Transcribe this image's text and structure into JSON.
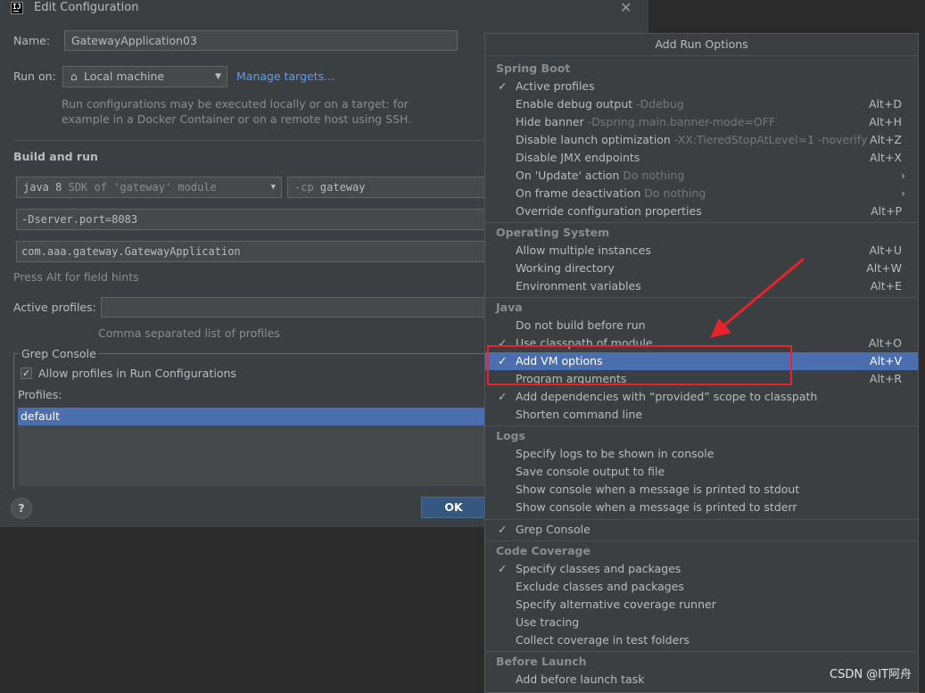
{
  "dialog": {
    "title": "Edit Configuration",
    "name_label": "Name:",
    "name_value": "GatewayApplication03",
    "run_on_label": "Run on:",
    "run_on_value": "Local machine",
    "manage_targets": "Manage targets...",
    "run_on_hint_line1": "Run configurations may be executed locally or on a target: for",
    "run_on_hint_line2": "example in a Docker Container or on a remote host using SSH.",
    "build_and_run": "Build and run",
    "jdk_value": "java 8",
    "jdk_hint": "SDK of 'gateway' module",
    "cp_prefix": "-cp",
    "cp_value": "gateway",
    "vm_options_value": "-Dserver.port=8083",
    "main_class_value": "com.aaa.gateway.GatewayApplication",
    "field_hints": "Press Alt for field hints",
    "active_profiles_label": "Active profiles:",
    "active_profiles_hint": "Comma separated list of profiles",
    "grep_console_legend": "Grep Console",
    "allow_profiles_label": "Allow profiles in Run Configurations",
    "profiles_label": "Profiles:",
    "profiles_item": "default",
    "help_label": "?",
    "ok_label": "OK"
  },
  "popup": {
    "title": "Add Run Options",
    "groups": {
      "spring_boot": "Spring Boot",
      "operating_system": "Operating System",
      "java": "Java",
      "logs": "Logs",
      "code_coverage": "Code Coverage",
      "before_launch": "Before Launch"
    },
    "items": [
      {
        "label": "Active profiles",
        "checked": true
      },
      {
        "label": "Enable debug output",
        "hint": "-Ddebug",
        "shortcut": "Alt+D"
      },
      {
        "label": "Hide banner",
        "hint": "-Dspring.main.banner-mode=OFF",
        "shortcut": "Alt+H"
      },
      {
        "label": "Disable launch optimization",
        "hint": "-XX:TieredStopAtLevel=1 -noverify",
        "shortcut": "Alt+Z"
      },
      {
        "label": "Disable JMX endpoints",
        "shortcut": "Alt+X"
      },
      {
        "label": "On 'Update' action",
        "hint": "Do nothing",
        "submenu": true
      },
      {
        "label": "On frame deactivation",
        "hint": "Do nothing",
        "submenu": true
      },
      {
        "label": "Override configuration properties",
        "shortcut": "Alt+P"
      },
      {
        "label": "Allow multiple instances",
        "shortcut": "Alt+U"
      },
      {
        "label": "Working directory",
        "shortcut": "Alt+W"
      },
      {
        "label": "Environment variables",
        "shortcut": "Alt+E"
      },
      {
        "label": "Do not build before run"
      },
      {
        "label": "Use classpath of module",
        "checked": true,
        "shortcut": "Alt+O"
      },
      {
        "label": "Add VM options",
        "checked": true,
        "selected": true,
        "shortcut": "Alt+V"
      },
      {
        "label": "Program arguments",
        "shortcut": "Alt+R"
      },
      {
        "label": "Add dependencies with “provided” scope to classpath",
        "checked": true
      },
      {
        "label": "Shorten command line"
      },
      {
        "label": "Specify logs to be shown in console"
      },
      {
        "label": "Save console output to file"
      },
      {
        "label": "Show console when a message is printed to stdout"
      },
      {
        "label": "Show console when a message is printed to stderr"
      },
      {
        "label": "Grep Console",
        "checked": true
      },
      {
        "label": "Specify classes and packages",
        "checked": true
      },
      {
        "label": "Exclude classes and packages"
      },
      {
        "label": "Specify alternative coverage runner"
      },
      {
        "label": "Use tracing"
      },
      {
        "label": "Collect coverage in test folders"
      },
      {
        "label": "Add before launch task"
      }
    ]
  },
  "watermark": "CSDN @IT阿舟",
  "check_glyph": "✓",
  "submenu_glyph": "›",
  "annotation_color": "#e8232b"
}
